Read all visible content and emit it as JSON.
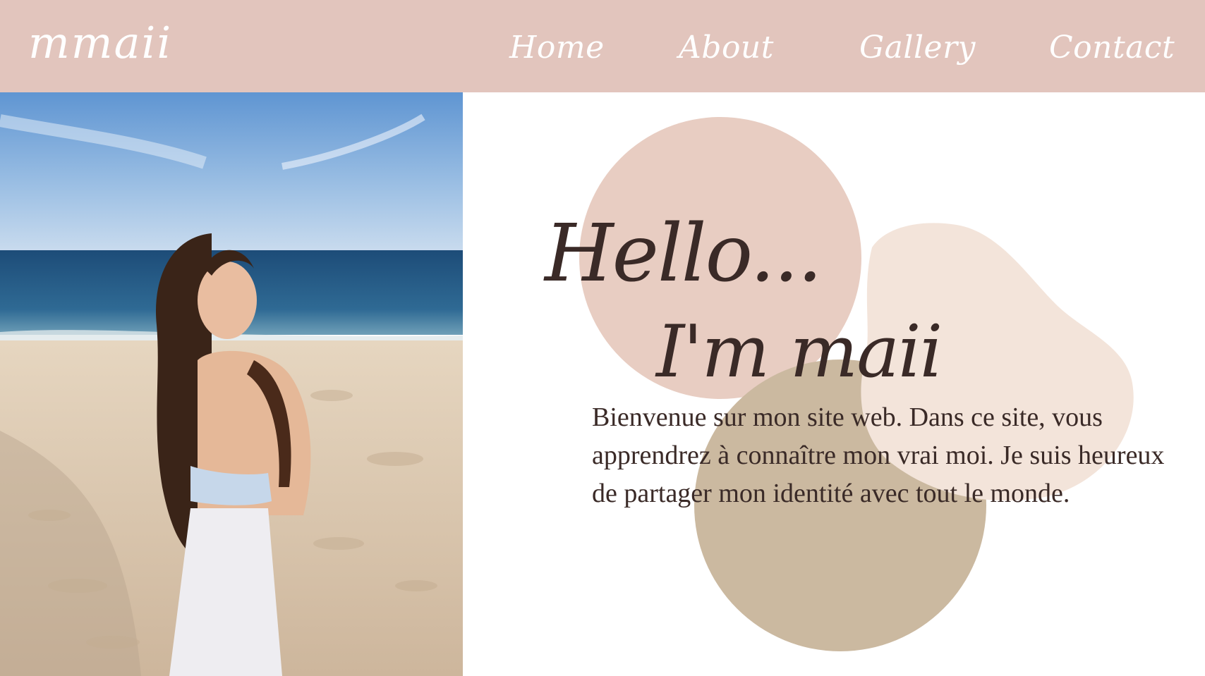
{
  "header": {
    "logo_text": "mmaii",
    "nav": [
      {
        "label": "Home"
      },
      {
        "label": "About"
      },
      {
        "label": "Gallery"
      },
      {
        "label": "Contact"
      }
    ]
  },
  "hero": {
    "greeting": "Hello...",
    "name_line": "I'm maii",
    "intro": "Bienvenue sur mon site web. Dans ce site, vous apprendrez à connaître mon vrai moi. Je suis heureux de partager mon identité avec tout le monde."
  },
  "colors": {
    "header_bg": "#e2c5bd",
    "text_dark": "#3a2a27",
    "blob_pink": "#e8cdc2",
    "blob_cream": "#f3e4da",
    "blob_tan": "#cbb9a0"
  }
}
